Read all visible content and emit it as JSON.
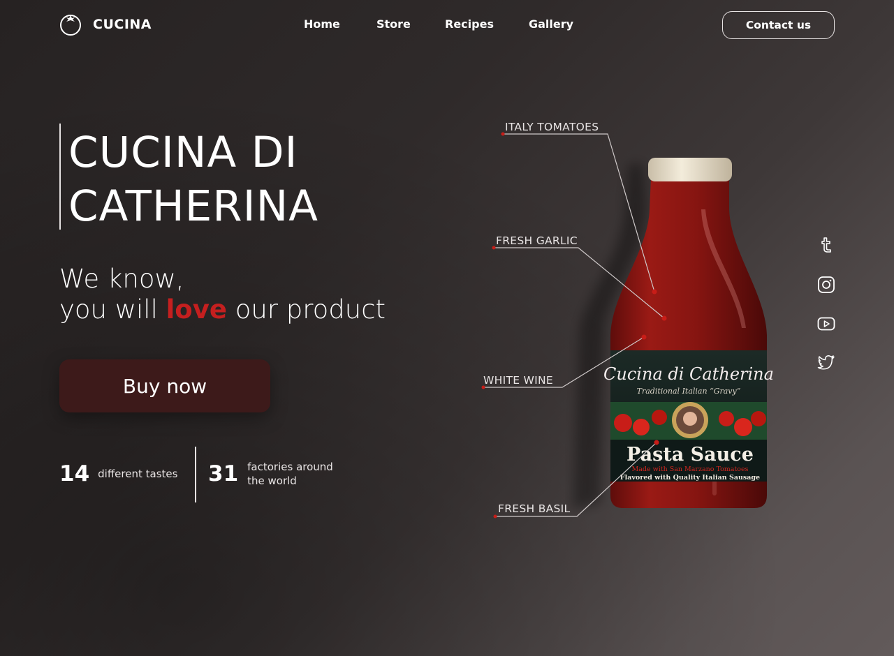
{
  "brand": {
    "name": "CUCINA"
  },
  "nav": {
    "items": [
      "Home",
      "Store",
      "Recipes",
      "Gallery"
    ]
  },
  "header": {
    "contact_label": "Contact us"
  },
  "hero": {
    "title_line1": "CUCINA DI",
    "title_line2": "CATHERINA",
    "tagline_line1": "We know,",
    "tagline_pre": "you will ",
    "tagline_emph": "love",
    "tagline_post": " our product",
    "cta_label": "Buy now"
  },
  "stats": [
    {
      "number": "14",
      "label_line1": "different tastes",
      "label_line2": ""
    },
    {
      "number": "31",
      "label_line1": "factories around",
      "label_line2": "the world"
    }
  ],
  "product": {
    "label_title": "Cucina di Catherina",
    "label_subtitle": "Traditional Italian “Gravy”",
    "label_name": "Pasta Sauce",
    "label_line1": "Made with San Marzano Tomatoes",
    "label_line2": "Flavored with Quality Italian Sausage",
    "callouts": [
      "ITALY TOMATOES",
      "FRESH GARLIC",
      "WHITE WINE",
      "FRESH BASIL"
    ]
  },
  "social": {
    "icons": [
      "tumblr-icon",
      "instagram-icon",
      "youtube-icon",
      "twitter-icon"
    ]
  },
  "colors": {
    "accent": "#c51f1f",
    "button": "#3d1a1a",
    "sauce": "#8e1612",
    "cap": "#ece2cc"
  }
}
